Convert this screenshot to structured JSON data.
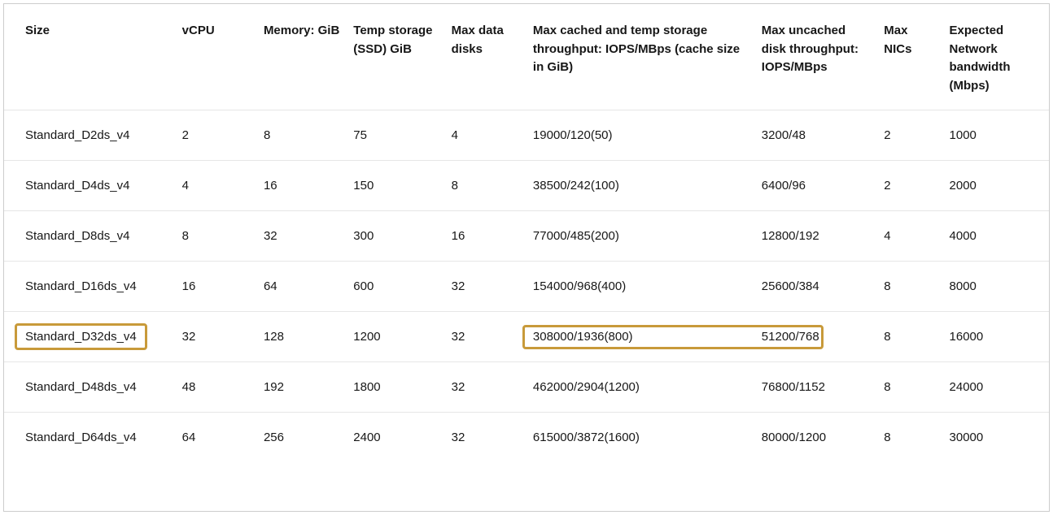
{
  "table": {
    "headers": [
      "Size",
      "vCPU",
      "Memory: GiB",
      "Temp storage (SSD) GiB",
      "Max data disks",
      "Max cached and temp storage throughput: IOPS/MBps (cache size in GiB)",
      "Max uncached disk throughput: IOPS/MBps",
      "Max NICs",
      "Expected Network bandwidth (Mbps)"
    ],
    "rows": [
      {
        "cells": [
          "Standard_D2ds_v4",
          "2",
          "8",
          "75",
          "4",
          "19000/120(50)",
          "3200/48",
          "2",
          "1000"
        ],
        "highlightSize": false,
        "highlightThroughput": false
      },
      {
        "cells": [
          "Standard_D4ds_v4",
          "4",
          "16",
          "150",
          "8",
          "38500/242(100)",
          "6400/96",
          "2",
          "2000"
        ],
        "highlightSize": false,
        "highlightThroughput": false
      },
      {
        "cells": [
          "Standard_D8ds_v4",
          "8",
          "32",
          "300",
          "16",
          "77000/485(200)",
          "12800/192",
          "4",
          "4000"
        ],
        "highlightSize": false,
        "highlightThroughput": false
      },
      {
        "cells": [
          "Standard_D16ds_v4",
          "16",
          "64",
          "600",
          "32",
          "154000/968(400)",
          "25600/384",
          "8",
          "8000"
        ],
        "highlightSize": false,
        "highlightThroughput": false
      },
      {
        "cells": [
          "Standard_D32ds_v4",
          "32",
          "128",
          "1200",
          "32",
          "308000/1936(800)",
          "51200/768",
          "8",
          "16000"
        ],
        "highlightSize": true,
        "highlightThroughput": true
      },
      {
        "cells": [
          "Standard_D48ds_v4",
          "48",
          "192",
          "1800",
          "32",
          "462000/2904(1200)",
          "76800/1152",
          "8",
          "24000"
        ],
        "highlightSize": false,
        "highlightThroughput": false
      },
      {
        "cells": [
          "Standard_D64ds_v4",
          "64",
          "256",
          "2400",
          "32",
          "615000/3872(1600)",
          "80000/1200",
          "8",
          "30000"
        ],
        "highlightSize": false,
        "highlightThroughput": false
      }
    ]
  }
}
